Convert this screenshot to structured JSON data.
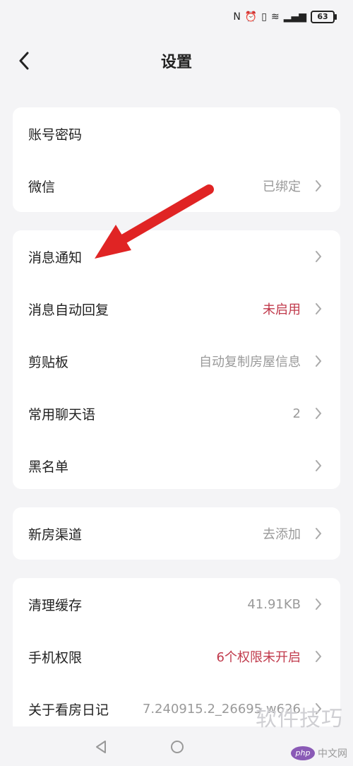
{
  "status": {
    "icons": [
      "nfc-icon",
      "alarm-icon",
      "vibrate-icon",
      "wifi-icon",
      "signal-4g-icon"
    ],
    "battery": "63"
  },
  "header": {
    "title": "设置"
  },
  "groups": [
    {
      "rows": [
        {
          "label": "账号密码",
          "value": ""
        },
        {
          "label": "微信",
          "value": "已绑定"
        }
      ]
    },
    {
      "rows": [
        {
          "label": "消息通知",
          "value": ""
        },
        {
          "label": "消息自动回复",
          "value": "未启用"
        },
        {
          "label": "剪贴板",
          "value": "自动复制房屋信息"
        },
        {
          "label": "常用聊天语",
          "value": "2"
        },
        {
          "label": "黑名单",
          "value": ""
        }
      ]
    },
    {
      "rows": [
        {
          "label": "新房渠道",
          "value": "去添加"
        }
      ]
    },
    {
      "rows": [
        {
          "label": "清理缓存",
          "value": "41.91KB"
        },
        {
          "label": "手机权限",
          "value": "6个权限未开启"
        },
        {
          "label": "关于看房日记",
          "value": "7.240915.2_26695 w626"
        }
      ]
    }
  ],
  "colors": {
    "accent_red": "#c0394b",
    "arrow_red": "#e02424"
  },
  "watermark": {
    "main": "软件技巧",
    "badge": "php",
    "site": "中文网"
  }
}
